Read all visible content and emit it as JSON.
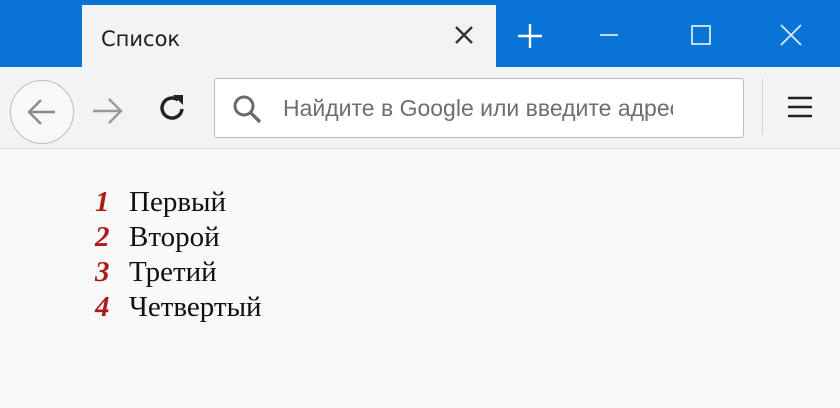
{
  "window": {
    "accent_color": "#0a74d6"
  },
  "tab": {
    "title": "Список",
    "close_icon": "close-icon"
  },
  "toolbar": {
    "search_placeholder": "Найдите в Google или введите адрес",
    "icons": [
      "back-arrow-icon",
      "forward-arrow-icon",
      "reload-icon",
      "search-icon",
      "hamburger-menu-icon"
    ]
  },
  "content": {
    "marker_color": "#b01919",
    "items": [
      {
        "number": "1",
        "label": "Первый"
      },
      {
        "number": "2",
        "label": "Второй"
      },
      {
        "number": "3",
        "label": "Третий"
      },
      {
        "number": "4",
        "label": "Четвертый"
      }
    ]
  }
}
